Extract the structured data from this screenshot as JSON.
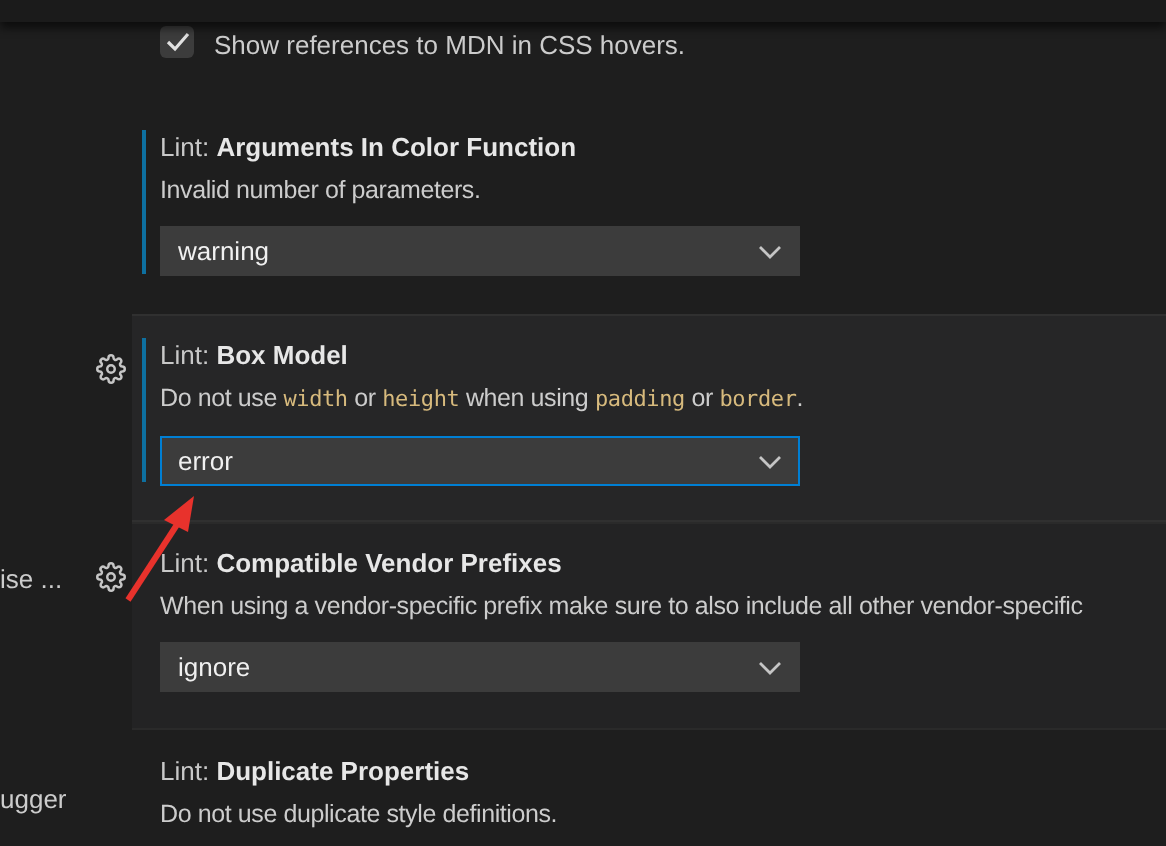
{
  "sidebar": {
    "items": [
      {
        "label": "ise ..."
      },
      {
        "label": "ugger"
      }
    ]
  },
  "checkbox_setting": {
    "label": "Show references to MDN in CSS hovers.",
    "checked": true
  },
  "settings": [
    {
      "prefix": "Lint: ",
      "name": "Arguments In Color Function",
      "modified": true,
      "focused": false,
      "hovered": false,
      "description": [
        {
          "kind": "text",
          "text": "Invalid number of parameters."
        }
      ],
      "dropdown": {
        "value": "warning"
      }
    },
    {
      "prefix": "Lint: ",
      "name": "Box Model",
      "modified": true,
      "focused": true,
      "hovered": false,
      "description": [
        {
          "kind": "text",
          "text": "Do not use "
        },
        {
          "kind": "code",
          "text": "width"
        },
        {
          "kind": "text",
          "text": " or "
        },
        {
          "kind": "code",
          "text": "height"
        },
        {
          "kind": "text",
          "text": " when using "
        },
        {
          "kind": "code",
          "text": "padding"
        },
        {
          "kind": "text",
          "text": " or "
        },
        {
          "kind": "code",
          "text": "border"
        },
        {
          "kind": "text",
          "text": "."
        }
      ],
      "dropdown": {
        "value": "error"
      }
    },
    {
      "prefix": "Lint: ",
      "name": "Compatible Vendor Prefixes",
      "modified": false,
      "focused": false,
      "hovered": true,
      "description": [
        {
          "kind": "text",
          "text": "When using a vendor-specific prefix make sure to also include all other vendor-specific"
        }
      ],
      "dropdown": {
        "value": "ignore"
      }
    },
    {
      "prefix": "Lint: ",
      "name": "Duplicate Properties",
      "modified": false,
      "focused": false,
      "hovered": false,
      "description": [
        {
          "kind": "text",
          "text": "Do not use duplicate style definitions."
        }
      ]
    }
  ]
}
